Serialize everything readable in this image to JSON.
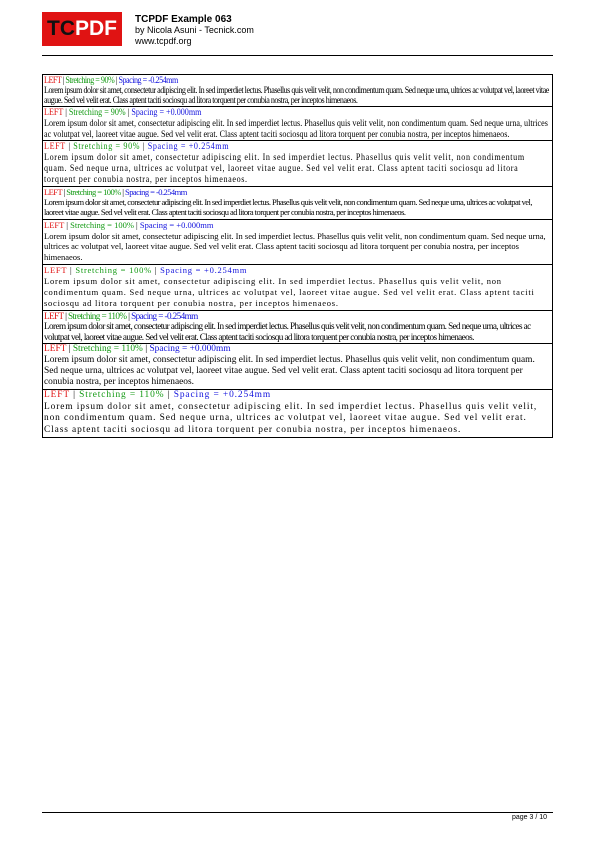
{
  "header": {
    "logo_part1": "TC",
    "logo_part2": "PDF",
    "title": "TCPDF Example 063",
    "author": "by Nicola Asuni - Tecnick.com",
    "url": "www.tcpdf.org"
  },
  "body_text": "Lorem ipsum dolor sit amet, consectetur adipiscing elit. In sed imperdiet lectus. Phasellus quis velit velit, non condimentum quam. Sed neque urna, ultrices ac volutpat vel, laoreet vitae augue. Sed vel velit erat. Class aptent taciti sociosqu ad litora torquent per conubia nostra, per inceptos himenaeos.",
  "blocks": [
    {
      "align": "LEFT",
      "stretch": "Stretching = 90%",
      "spacing": "Spacing = -0.254mm"
    },
    {
      "align": "LEFT",
      "stretch": "Stretching = 90%",
      "spacing": "Spacing = +0.000mm"
    },
    {
      "align": "LEFT",
      "stretch": "Stretching = 90%",
      "spacing": "Spacing = +0.254mm"
    },
    {
      "align": "LEFT",
      "stretch": "Stretching = 100%",
      "spacing": "Spacing = -0.254mm"
    },
    {
      "align": "LEFT",
      "stretch": "Stretching = 100%",
      "spacing": "Spacing = +0.000mm"
    },
    {
      "align": "LEFT",
      "stretch": "Stretching = 100%",
      "spacing": "Spacing = +0.254mm"
    },
    {
      "align": "LEFT",
      "stretch": "Stretching = 110%",
      "spacing": "Spacing = -0.254mm"
    },
    {
      "align": "LEFT",
      "stretch": "Stretching = 110%",
      "spacing": "Spacing = +0.000mm"
    },
    {
      "align": "LEFT",
      "stretch": "Stretching = 110%",
      "spacing": "Spacing = +0.254mm"
    }
  ],
  "separator": " | ",
  "footer": {
    "page": "page 3 / 10"
  },
  "colors": {
    "align": "#e01313",
    "stretch": "#119911",
    "spacing": "#1111dd"
  }
}
